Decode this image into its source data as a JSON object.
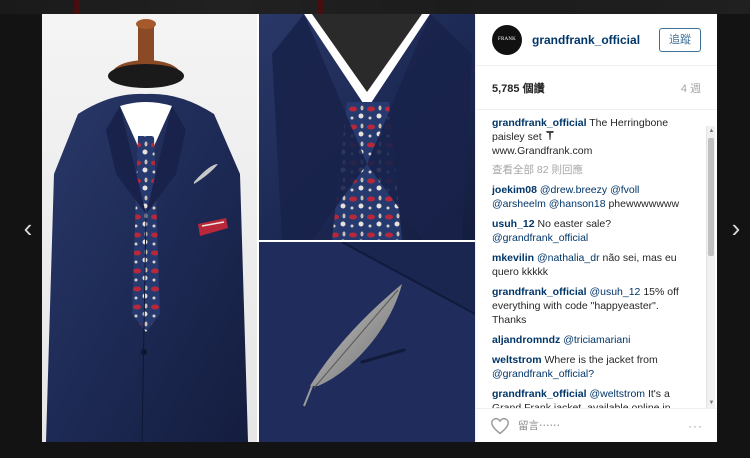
{
  "post": {
    "username": "grandfrank_official",
    "avatar_text": "FRANK",
    "follow_label": "追蹤",
    "likes": "5,785 個讚",
    "age": "4 週",
    "caption": {
      "author": "grandfrank_official",
      "text_line1": "The Herringbone paisley set",
      "text_line2": "www.Grandfrank.com"
    },
    "view_all": "查看全部 82 則回應",
    "comments": [
      {
        "author": "joekim08",
        "mentions": "@drew.breezy @fvoll @arsheelm @hanson18",
        "text": "phewwwwwww"
      },
      {
        "author": "usuh_12",
        "text": "No easter sale?",
        "mention": "@grandfrank_official"
      },
      {
        "author": "mkevilin",
        "mention": "@nathalia_dr",
        "text": "não sei, mas eu quero kkkkk"
      },
      {
        "author": "grandfrank_official",
        "mention": "@usuh_12",
        "text": "15% off everything with code \"happyeaster\". Thanks"
      },
      {
        "author": "aljandromndz",
        "mention": "@triciamariani",
        "text": ""
      },
      {
        "author": "weltstrom",
        "text": "Where is the jacket from",
        "mention": "@grandfrank_official?"
      },
      {
        "author": "grandfrank_official",
        "mention": "@weltstrom",
        "text": "It's a Grand Frank jacket, available online in May. Thanks"
      }
    ],
    "comment_placeholder": "留言⋯⋯",
    "more_label": "···"
  },
  "nav": {
    "prev": "‹",
    "next": "›"
  },
  "scroll": {
    "up": "▲",
    "down": "▼"
  },
  "colors": {
    "link": "#003569",
    "follow": "#3f729b",
    "suit": "#1d2a55",
    "tie": "#24346b",
    "paisley": "#b8283a"
  },
  "icons": [
    "pin-icon",
    "heart-icon",
    "chevron-left-icon",
    "chevron-right-icon"
  ]
}
